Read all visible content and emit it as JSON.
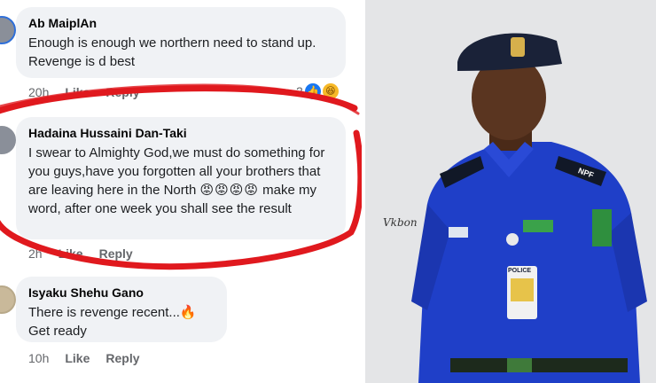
{
  "comments": [
    {
      "author": "Ab MaiplAn",
      "text": "Enough is enough we northern need to stand up. Revenge is d best",
      "time": "20h",
      "like_label": "Like",
      "reply_label": "Reply",
      "reaction_count": "2"
    },
    {
      "author": "Hadaina Hussaini Dan-Taki",
      "text_before_emoji": "I swear to Almighty God,we must do something for you guys,have you forgotten all your brothers that are leaving here in the North ",
      "emojis": "😡😡😡😡",
      "text_after_emoji": " make my word, after one week you shall see the result",
      "time": "2h",
      "like_label": "Like",
      "reply_label": "Reply"
    },
    {
      "author": "Isyaku Shehu Gano",
      "text": "There is revenge recent...🔥\nGet ready",
      "time": "10h",
      "like_label": "Like",
      "reply_label": "Reply"
    }
  ],
  "photo": {
    "badge_text": "NPF",
    "tag_text": "POLICE",
    "watermark": "Vkbon"
  },
  "colors": {
    "bubble": "#f0f2f5",
    "annotation_red": "#e0191e",
    "uniform_blue": "#1f3fc8",
    "beret": "#1a2238",
    "like_blue": "#1877f2"
  }
}
